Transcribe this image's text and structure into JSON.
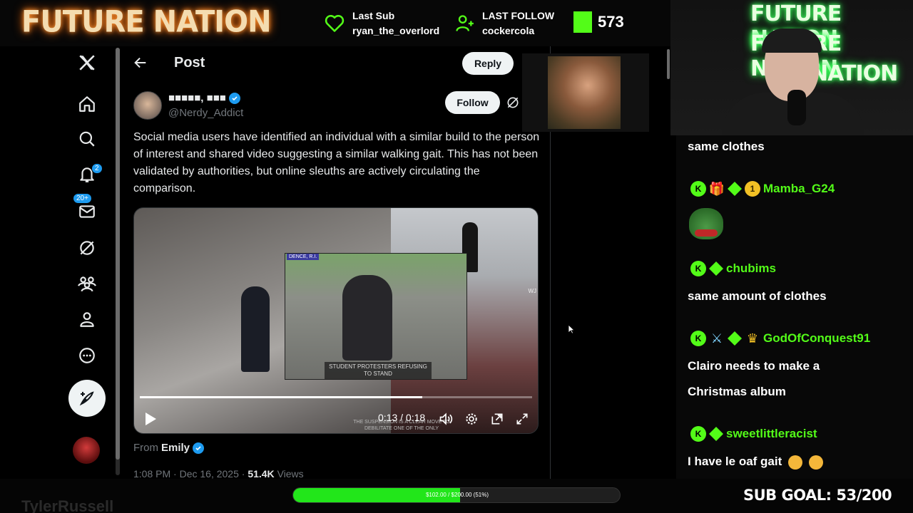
{
  "stream": {
    "brand": "FUTURE NATION",
    "last_sub_label": "Last Sub",
    "last_sub_value": "ryan_the_overlord",
    "last_follow_label": "LAST FOLLOW",
    "last_follow_value": "cockercola",
    "viewer_count": "573",
    "webcam_neon": [
      "FUTURE NATION",
      "FUTURE NATION",
      "NATION"
    ],
    "streamer_name": "TylerRussell",
    "goal_text": "$102.00 / $200.00 (51%)",
    "goal_progress": 0.51,
    "sub_goal": "SUB GOAL: 53/200"
  },
  "nav": {
    "notifications_badge": "2",
    "messages_badge": "20+"
  },
  "post": {
    "header_title": "Post",
    "reply_label": "Reply",
    "author_name": "■■■■■, ■■■",
    "author_handle": "@Nerdy_Addict",
    "follow_label": "Follow",
    "text": "Social media users have identified an individual with a similar build to the person of interest and shared video suggesting a similar walking gait. This has not been validated by authorities, but online sleuths are actively circulating the comparison.",
    "video": {
      "tag": "DENCE, R.I.",
      "corner_tag": "WJ",
      "caption": "STUDENT PROTESTERS REFUSING TO STAND",
      "subtitle": "THE SUSPENSION IS A CLEAR MOVE TO DEBILITATE ONE OF THE ONLY",
      "time": "0:13 / 0:18",
      "progress": 0.72
    },
    "from_label": "From",
    "from_name": "Emily",
    "timestamp": "1:08 PM · Dec 16, 2025 ·",
    "views_count": "51.4K",
    "views_label": "Views"
  },
  "chat": {
    "messages": [
      {
        "text": "same clothes"
      },
      {
        "user": "Mamba_G24"
      },
      {
        "user": "chubims",
        "text": "same amount of clothes"
      },
      {
        "user": "GodOfConquest91",
        "text": "Clairo needs to make a",
        "text2": "Christmas album"
      },
      {
        "user": "sweetlittleracist",
        "text": "I have le oaf gait"
      }
    ],
    "coin_badge": "1"
  }
}
